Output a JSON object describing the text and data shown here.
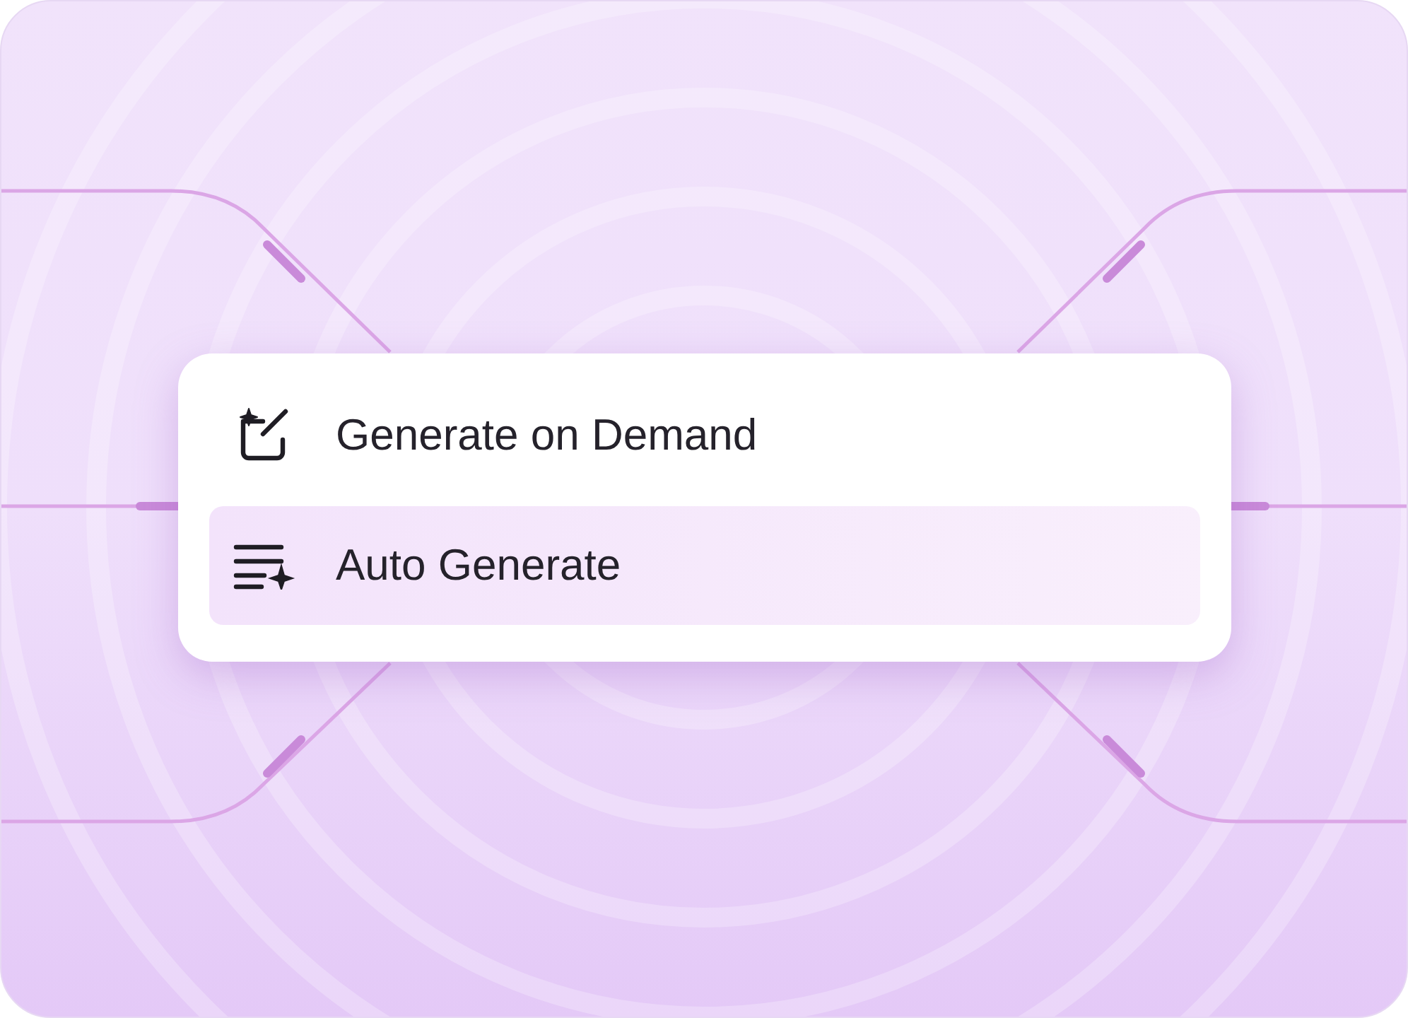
{
  "menu": {
    "items": [
      {
        "kind": "edit-sparkle",
        "label": "Generate on Demand",
        "selected": false
      },
      {
        "kind": "list-sparkle",
        "label": "Auto Generate",
        "selected": true
      }
    ]
  }
}
